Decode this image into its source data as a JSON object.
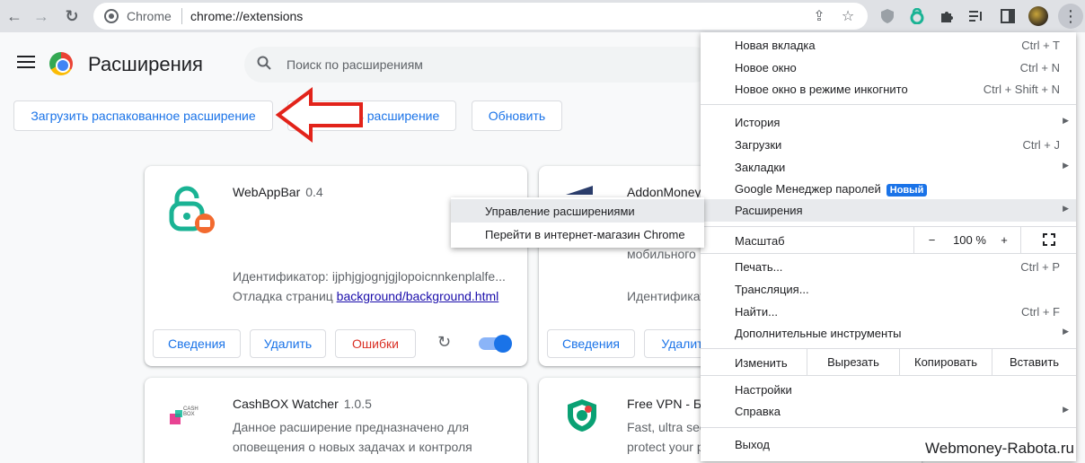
{
  "browser": {
    "site_label": "Chrome",
    "url": "chrome://extensions"
  },
  "header": {
    "title": "Расширения",
    "search_placeholder": "Поиск по расширениям"
  },
  "dev_buttons": {
    "load_unpacked": "Загрузить распакованное расширение",
    "pack": "Упаковать расширение",
    "update": "Обновить"
  },
  "cards": [
    {
      "name": "WebAppBar",
      "version": "0.4",
      "id_line": "Идентификатор: ijphjgjognjgjlopoicnnkenplalfe...",
      "debug_prefix": "Отладка страниц",
      "debug_link": "background/background.html",
      "details_button": "Сведения",
      "remove_button": "Удалить",
      "errors_button": "Ошибки",
      "enabled": true
    },
    {
      "name": "AddonMoney",
      "line1": "мобильного",
      "line2": "Идентификат",
      "details_button": "Сведения",
      "remove_button": "Удалит"
    },
    {
      "name": "CashBOX Watcher",
      "version": "1.0.5",
      "logo_text": "CASH BOX",
      "desc1": "Данное расширение предназначено для",
      "desc2": "оповещения о новых задачах и контроля"
    },
    {
      "name": "Free VPN - Бе",
      "desc1": "Fast, ultra sec",
      "desc2": "protect your p"
    }
  ],
  "menu": {
    "new_tab": {
      "label": "Новая вкладка",
      "shortcut": "Ctrl + T"
    },
    "new_window": {
      "label": "Новое окно",
      "shortcut": "Ctrl + N"
    },
    "incognito": {
      "label": "Новое окно в режиме инкогнито",
      "shortcut": "Ctrl + Shift + N"
    },
    "history": {
      "label": "История"
    },
    "downloads": {
      "label": "Загрузки",
      "shortcut": "Ctrl + J"
    },
    "bookmarks": {
      "label": "Закладки"
    },
    "password_manager": {
      "label": "Google Менеджер паролей",
      "badge": "Новый"
    },
    "extensions": {
      "label": "Расширения"
    },
    "zoom": {
      "label": "Масштаб",
      "minus": "−",
      "value": "100 %",
      "plus": "+"
    },
    "print": {
      "label": "Печать...",
      "shortcut": "Ctrl + P"
    },
    "cast": {
      "label": "Трансляция..."
    },
    "find": {
      "label": "Найти...",
      "shortcut": "Ctrl + F"
    },
    "more_tools": {
      "label": "Дополнительные инструменты"
    },
    "edit": {
      "label": "Изменить",
      "cut": "Вырезать",
      "copy": "Копировать",
      "paste": "Вставить"
    },
    "settings": {
      "label": "Настройки"
    },
    "help": {
      "label": "Справка"
    },
    "exit": {
      "label": "Выход"
    }
  },
  "submenu": {
    "manage": "Управление расширениями",
    "webstore": "Перейти в интернет-магазин Chrome"
  },
  "watermark": "Webmoney-Rabota.ru"
}
